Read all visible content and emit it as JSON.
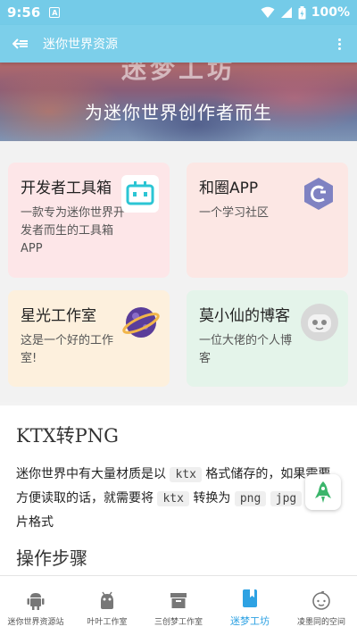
{
  "status_bar": {
    "time": "9:56",
    "notification_glyph": "A",
    "battery_text": "100%"
  },
  "app_bar": {
    "title": "迷你世界资源"
  },
  "banner": {
    "ghost_text": "迷梦工坊",
    "subtitle": "为迷你世界创作者而生"
  },
  "cards": [
    {
      "title": "开发者工具箱",
      "description": "一款专为迷你世界开发者而生的工具箱APP",
      "icon": "toolbox-robot-icon",
      "bg": "#fde6e8"
    },
    {
      "title": "和圈APP",
      "description": "一个学习社区",
      "icon": "hequan-logo-icon",
      "bg": "#fce7e4"
    },
    {
      "title": "星光工作室",
      "description": "这是一个好的工作室!",
      "icon": "planet-icon",
      "bg": "#fdf0dd"
    },
    {
      "title": "莫小仙的博客",
      "description": "一位大佬的个人博客",
      "icon": "robot-avatar-icon",
      "bg": "#e4f4ea"
    }
  ],
  "article": {
    "title": "KTX转PNG",
    "p_part1": "迷你世界中有大量材质是以",
    "code1": "ktx",
    "p_part2": "格式储存的，如果需要方便读取的话，就需要将",
    "code2": "ktx",
    "p_part3": "转换为",
    "code3": "png",
    "code4": "jpg",
    "p_part4": "等图片格式",
    "section_heading": "操作步骤"
  },
  "bottom_nav": [
    {
      "label": "迷你世界资源站",
      "icon": "android-icon",
      "active": false
    },
    {
      "label": "叶叶工作室",
      "icon": "android-head-icon",
      "active": false
    },
    {
      "label": "三创梦工作室",
      "icon": "archive-box-icon",
      "active": false
    },
    {
      "label": "迷梦工坊",
      "icon": "bookmark-book-icon",
      "active": true
    },
    {
      "label": "凌墨同的空间",
      "icon": "face-icon",
      "active": false
    }
  ],
  "colors": {
    "accent": "#2ea2e3",
    "appbar": "#7ccfea",
    "statusbar": "#74cbe8",
    "fab_rocket": "#3bb56b"
  }
}
